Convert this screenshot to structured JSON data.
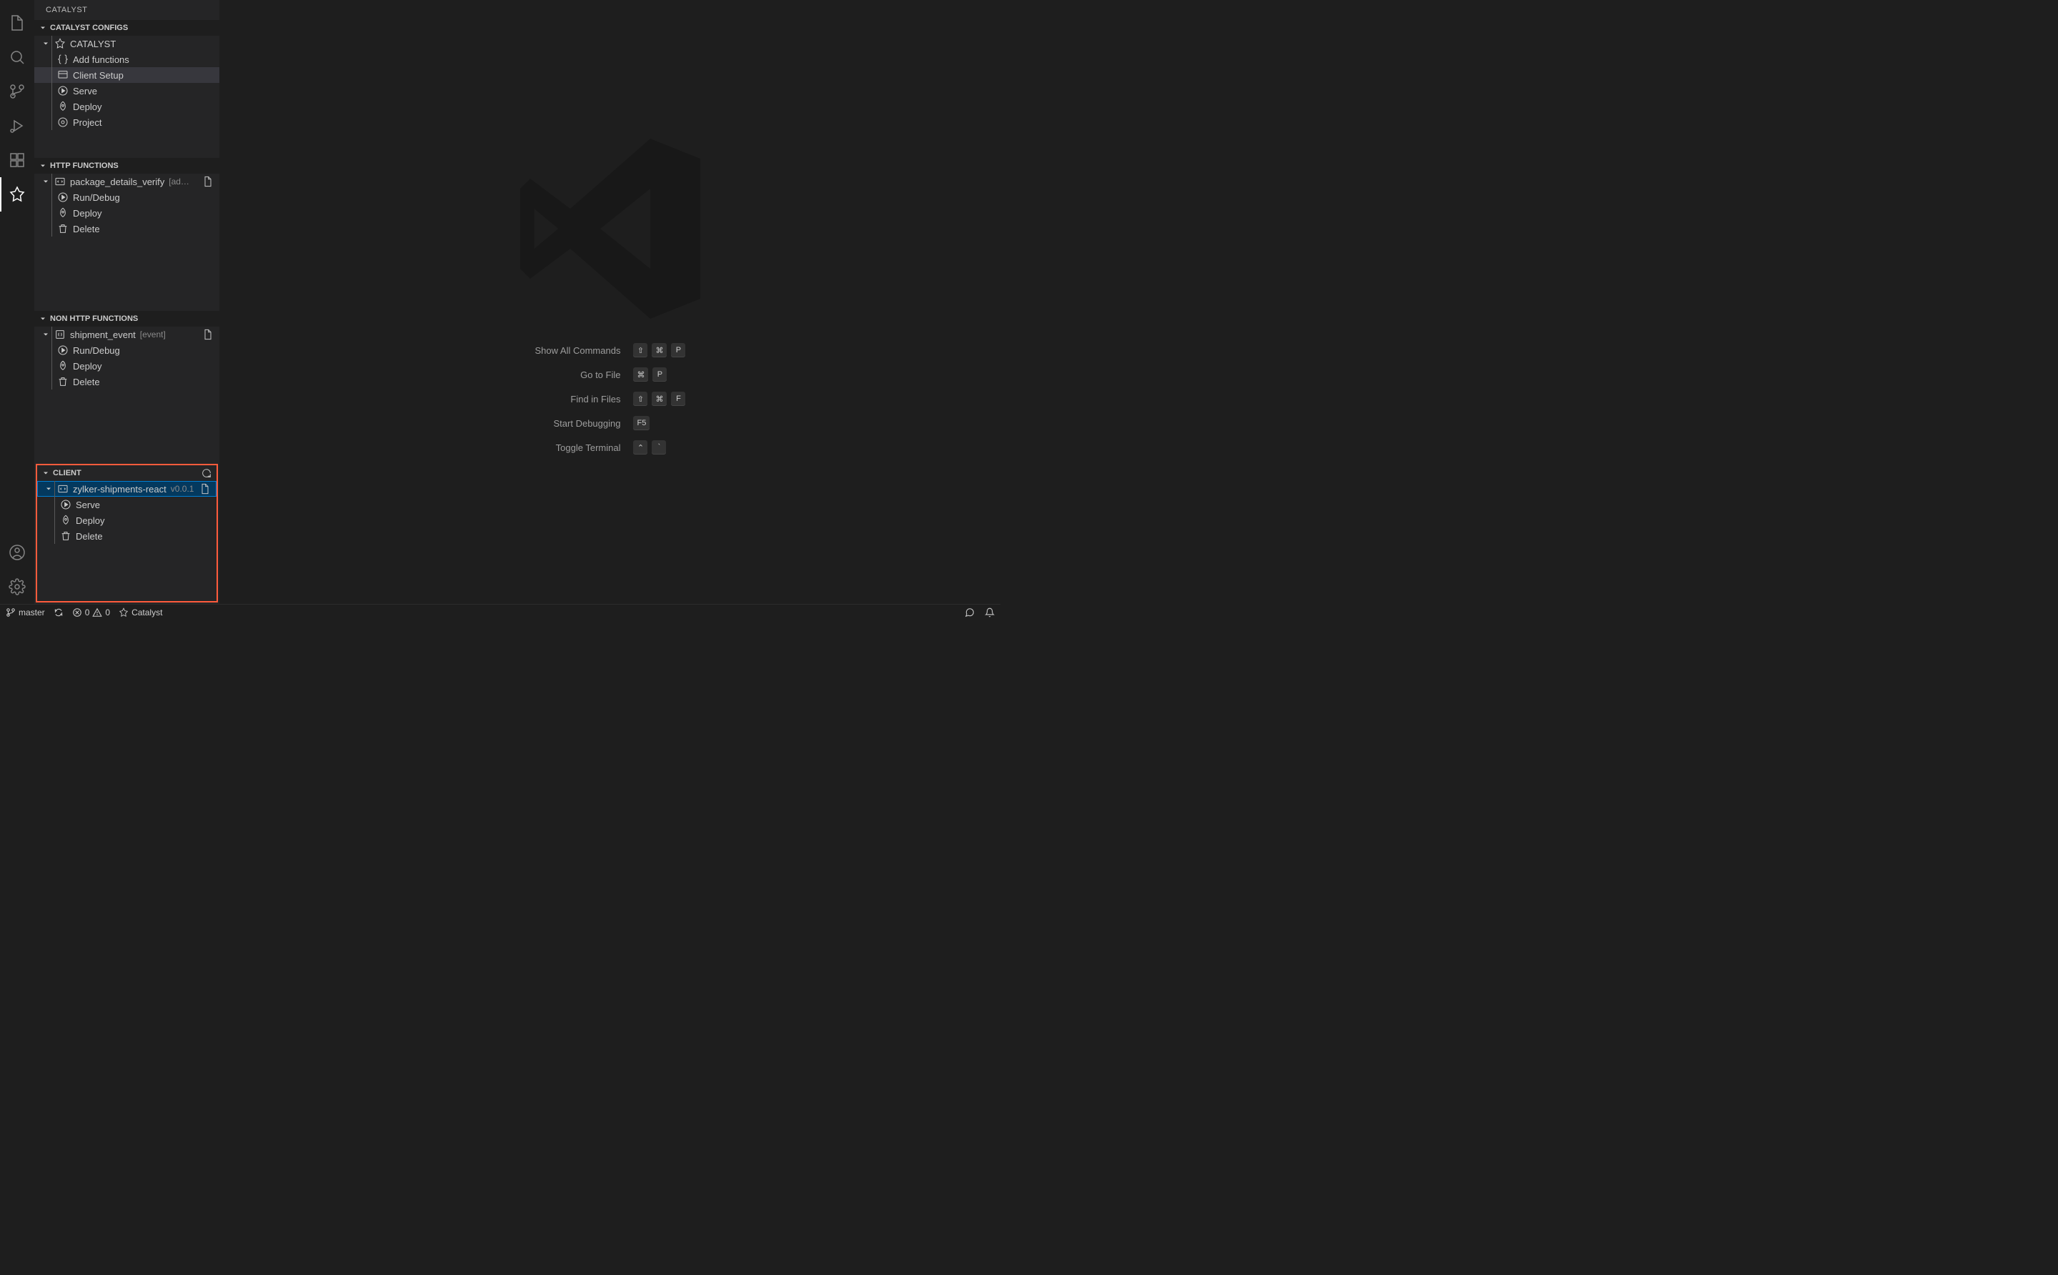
{
  "sidebar": {
    "title": "CATALYST",
    "sections": {
      "configs": {
        "header": "CATALYST CONFIGS",
        "root": "CATALYST",
        "items": [
          "Add functions",
          "Client Setup",
          "Serve",
          "Deploy",
          "Project"
        ]
      },
      "http": {
        "header": "HTTP FUNCTIONS",
        "root": "package_details_verify",
        "root_tag": "[ad…",
        "items": [
          "Run/Debug",
          "Deploy",
          "Delete"
        ]
      },
      "nonhttp": {
        "header": "NON HTTP FUNCTIONS",
        "root": "shipment_event",
        "root_tag": "[event]",
        "items": [
          "Run/Debug",
          "Deploy",
          "Delete"
        ]
      },
      "client": {
        "header": "CLIENT",
        "root": "zylker-shipments-react",
        "root_tag": "v0.0.1",
        "items": [
          "Serve",
          "Deploy",
          "Delete"
        ]
      }
    }
  },
  "main_actions": [
    {
      "label": "Show All Commands",
      "keys": [
        "⇧",
        "⌘",
        "P"
      ]
    },
    {
      "label": "Go to File",
      "keys": [
        "⌘",
        "P"
      ]
    },
    {
      "label": "Find in Files",
      "keys": [
        "⇧",
        "⌘",
        "F"
      ]
    },
    {
      "label": "Start Debugging",
      "keys": [
        "F5"
      ]
    },
    {
      "label": "Toggle Terminal",
      "keys": [
        "⌃",
        "`"
      ]
    }
  ],
  "status": {
    "branch": "master",
    "errors": "0",
    "warnings": "0",
    "workspace": "Catalyst"
  }
}
